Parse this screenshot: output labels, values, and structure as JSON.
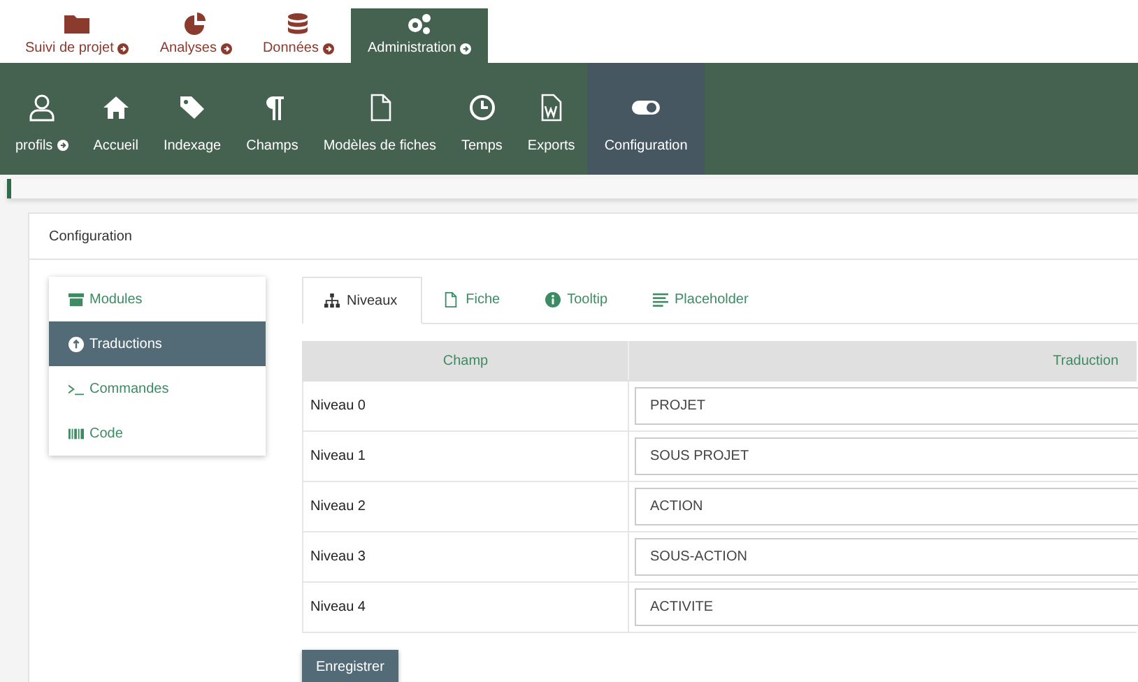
{
  "top_tabs": [
    {
      "label": "Suivi de projet",
      "dropdown": true,
      "selected": false
    },
    {
      "label": "Analyses",
      "dropdown": true,
      "selected": false
    },
    {
      "label": "Données",
      "dropdown": true,
      "selected": false
    },
    {
      "label": "Administration",
      "dropdown": true,
      "selected": true
    }
  ],
  "nav": [
    {
      "label": "profils",
      "dropdown": true,
      "selected": false
    },
    {
      "label": "Accueil",
      "dropdown": false,
      "selected": false
    },
    {
      "label": "Indexage",
      "dropdown": false,
      "selected": false
    },
    {
      "label": "Champs",
      "dropdown": false,
      "selected": false
    },
    {
      "label": "Modèles de fiches",
      "dropdown": false,
      "selected": false
    },
    {
      "label": "Temps",
      "dropdown": false,
      "selected": false
    },
    {
      "label": "Exports",
      "dropdown": false,
      "selected": false
    },
    {
      "label": "Configuration",
      "dropdown": false,
      "selected": true
    }
  ],
  "panel": {
    "title": "Configuration"
  },
  "side_menu": [
    {
      "label": "Modules",
      "selected": false
    },
    {
      "label": "Traductions",
      "selected": true
    },
    {
      "label": "Commandes",
      "selected": false
    },
    {
      "label": "Code",
      "selected": false
    }
  ],
  "tabs": [
    {
      "label": "Niveaux",
      "selected": true
    },
    {
      "label": "Fiche",
      "selected": false
    },
    {
      "label": "Tooltip",
      "selected": false
    },
    {
      "label": "Placeholder",
      "selected": false
    }
  ],
  "table": {
    "columns": [
      "Champ",
      "Traduction"
    ],
    "rows": [
      {
        "field": "Niveau 0",
        "value": "PROJET"
      },
      {
        "field": "Niveau 1",
        "value": "SOUS PROJET"
      },
      {
        "field": "Niveau 2",
        "value": "ACTION"
      },
      {
        "field": "Niveau 3",
        "value": "SOUS-ACTION"
      },
      {
        "field": "Niveau 4",
        "value": "ACTIVITE"
      }
    ]
  },
  "save_button": "Enregistrer"
}
